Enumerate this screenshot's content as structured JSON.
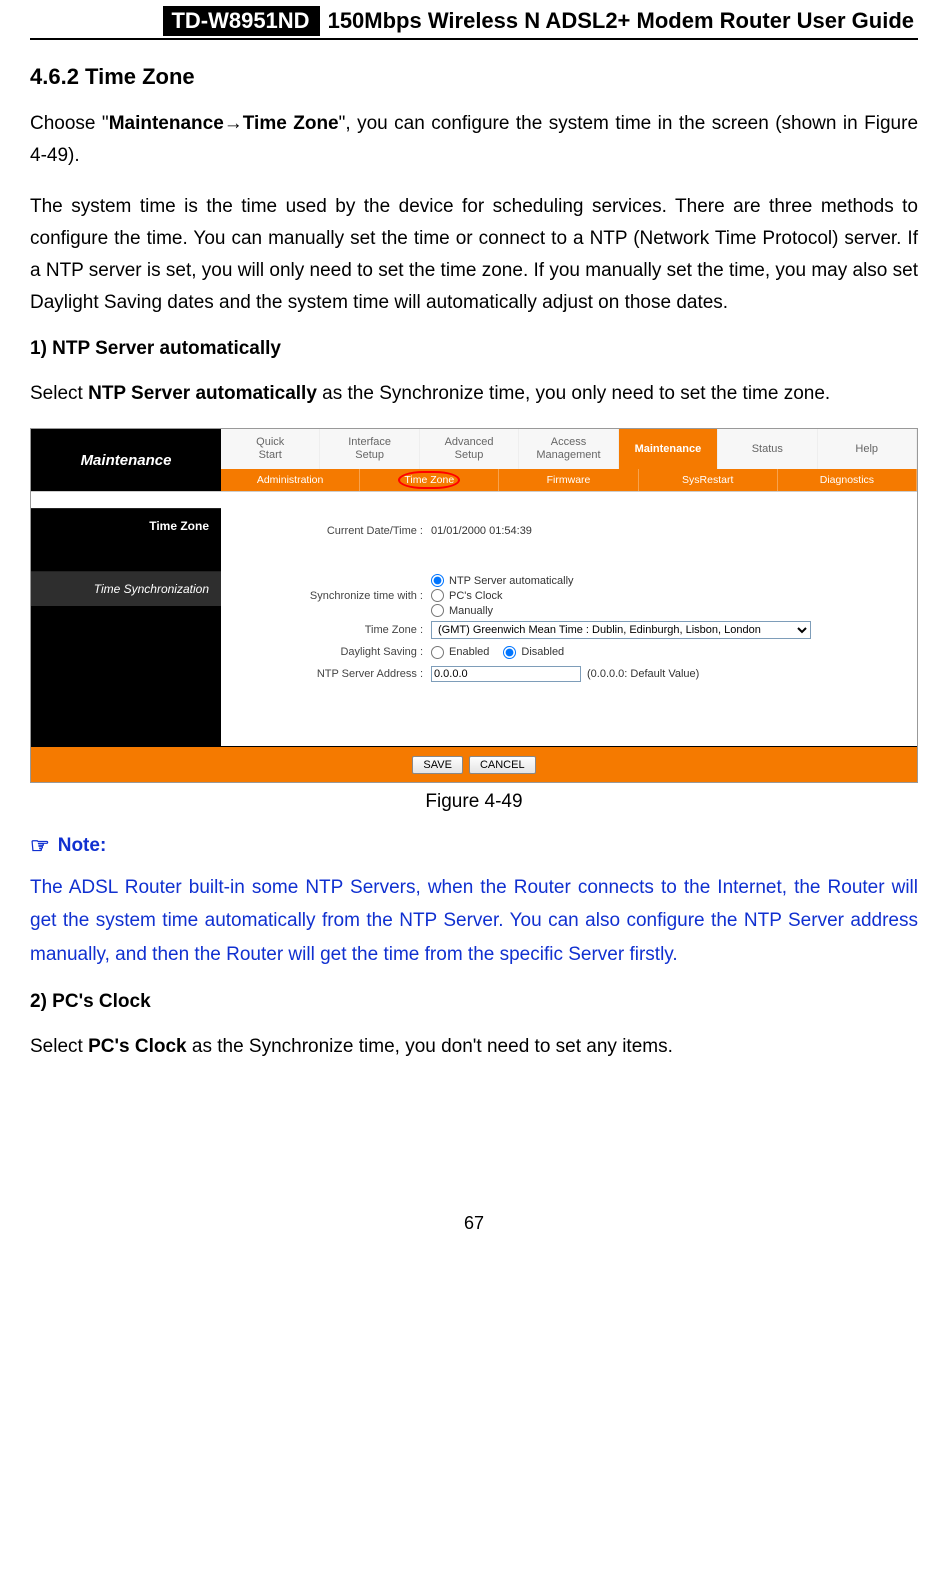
{
  "header": {
    "model": "TD-W8951ND",
    "title": "150Mbps Wireless N ADSL2+ Modem Router User Guide"
  },
  "section": {
    "number_title": "4.6.2  Time Zone"
  },
  "para1_pre": "Choose \"",
  "para1_bold1": "Maintenance",
  "para1_arrow": "→",
  "para1_bold2": "Time Zone",
  "para1_post": "\", you can configure the system time in the screen (shown in Figure 4-49).",
  "para2": "The system time is the time used by the device for scheduling services. There are three methods to configure the time. You can manually set the time or connect to a NTP (Network Time Protocol) server. If a NTP server is set, you will only need to set the time zone. If you manually set the time, you may also set Daylight Saving dates and the system time will automatically adjust on those dates.",
  "list1": "1)    NTP Server automatically",
  "para3_pre": "Select ",
  "para3_bold": "NTP Server automatically",
  "para3_post": " as the Synchronize time, you only need to set the time zone.",
  "figure_caption": "Figure 4-49",
  "note_label": "Note:",
  "note_body": "The ADSL Router built-in some NTP Servers, when the Router connects to the Internet, the Router will get the system time automatically from the NTP Server. You can also configure the NTP Server address manually, and then the Router will get the time from the specific Server firstly.",
  "list2": "2)    PC's Clock",
  "para4_pre": "Select ",
  "para4_bold": "PC's Clock",
  "para4_post": " as the Synchronize time, you don't need to set any items.",
  "page_number": "67",
  "ui": {
    "left_title": "Maintenance",
    "top_tabs": [
      "Quick\nStart",
      "Interface\nSetup",
      "Advanced\nSetup",
      "Access\nManagement",
      "Maintenance",
      "Status",
      "Help"
    ],
    "active_top_tab_index": 4,
    "sub_tabs": [
      "Administration",
      "Time Zone",
      "Firmware",
      "SysRestart",
      "Diagnostics"
    ],
    "selected_sub_tab_index": 1,
    "side_label_1": "Time Zone",
    "side_label_2": "Time Synchronization",
    "current_dt_label": "Current Date/Time :",
    "current_dt_value": "01/01/2000 01:54:39",
    "sync_label": "Synchronize time with :",
    "sync_options": [
      "NTP Server automatically",
      "PC's Clock",
      "Manually"
    ],
    "sync_selected_index": 0,
    "tz_label": "Time Zone :",
    "tz_value": "(GMT) Greenwich Mean Time : Dublin, Edinburgh, Lisbon, London",
    "ds_label": "Daylight Saving :",
    "ds_options": [
      "Enabled",
      "Disabled"
    ],
    "ds_selected_index": 1,
    "ntp_label": "NTP Server Address :",
    "ntp_value": "0.0.0.0",
    "ntp_hint": "(0.0.0.0: Default Value)",
    "save_label": "SAVE",
    "cancel_label": "CANCEL"
  }
}
